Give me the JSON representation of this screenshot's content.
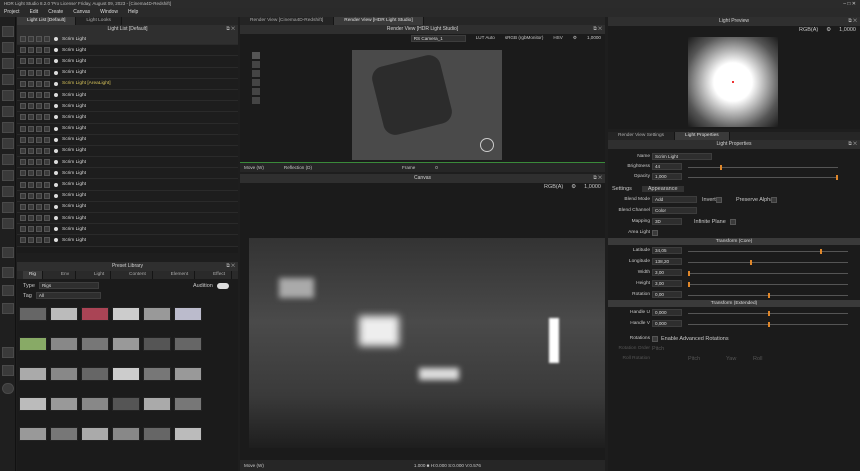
{
  "app": {
    "title": "HDR Light Studio 8.2.0 'Pro License' Friday, August 09, 2023 - [Cinema4D-Redshift]",
    "menu": [
      "Project",
      "Edit",
      "Create",
      "Canvas",
      "Window",
      "Help"
    ],
    "win_btns": "–  □  ✕"
  },
  "light_list": {
    "tabs": [
      "Light List [Default]",
      "Light Looks"
    ],
    "header": "Light List [Default]",
    "rows": [
      {
        "label": "Scrim Light"
      },
      {
        "label": "Scrim Light"
      },
      {
        "label": "Scrim Light"
      },
      {
        "label": "Scrim Light"
      },
      {
        "label": "Scrim Light [AreaLight]"
      },
      {
        "label": "Scrim Light"
      },
      {
        "label": "Scrim Light"
      },
      {
        "label": "Scrim Light"
      },
      {
        "label": "Scrim Light"
      },
      {
        "label": "Scrim Light"
      },
      {
        "label": "Scrim Light"
      },
      {
        "label": "Scrim Light"
      },
      {
        "label": "Scrim Light"
      },
      {
        "label": "Scrim Light"
      },
      {
        "label": "Scrim Light"
      },
      {
        "label": "Scrim Light"
      },
      {
        "label": "Scrim Light"
      },
      {
        "label": "Scrim Light"
      },
      {
        "label": "Scrim Light"
      }
    ]
  },
  "preset": {
    "header": "Preset Library",
    "tabs": [
      "Rig",
      "Env",
      "Light",
      "Content",
      "Element",
      "Effect"
    ],
    "type_label": "Type",
    "type_value": "Rigs",
    "tag_label": "Tag",
    "tag_value": "All",
    "audition": "Audition"
  },
  "render": {
    "tabs": [
      "Render View [Cinema4D-Redshift]",
      "Render View [HDR Light Studio]"
    ],
    "header": "Render View [HDR Light Studio]",
    "camera": "RS Camera_1",
    "lut": "LUT Auto",
    "colorspace": "sRGB (rgbMonitor)",
    "mode": "HSV",
    "value": "1,0000",
    "move": "Move (W)",
    "reflection": "Reflection (D)",
    "frame_label": "Frame",
    "frame_value": "0"
  },
  "canvas": {
    "header": "Canvas",
    "channel": "RGB(A)",
    "value": "1,0000",
    "move": "Move (W)",
    "status": "1.000 ■ H:0.000 S:0.000 V:0.576"
  },
  "preview": {
    "header": "Light Preview",
    "channel": "RGB(A)",
    "value": "1,0000"
  },
  "props": {
    "tabs": [
      "Render View Settings",
      "Light Properties"
    ],
    "header": "Light Properties",
    "name_label": "Name",
    "name_value": "Scrim Light",
    "brightness_label": "Brightness",
    "brightness_value": "44",
    "opacity_label": "Opacity",
    "opacity_value": "1,000",
    "subtabs": [
      "Settings",
      "Appearance"
    ],
    "blend_label": "Blend Mode",
    "blend_value": "Add",
    "invert": "Invert",
    "preserve_alpha": "Preserve Alpha",
    "channel_label": "Blend Channel",
    "channel_value": "Color",
    "mapping_label": "Mapping",
    "mapping_value": "3D",
    "infinite": "Infinite Plane",
    "area_label": "Area Light",
    "transform_core": "Transform (Core)",
    "latitude_label": "Latitude",
    "latitude_value": "34,05",
    "longitude_label": "Longitude",
    "longitude_value": "138,20",
    "width_label": "Width",
    "width_value": "3,00",
    "height_label": "Height",
    "height_value": "3,00",
    "rotation_label": "Rotation",
    "rotation_value": "0,00",
    "transform_ext": "Transform (Extended)",
    "handleu_label": "Handle U",
    "handleu_value": "0,000",
    "handlev_label": "Handle V",
    "handlev_value": "0,000",
    "rotations_label": "Rotations",
    "adv_rot": "Enable Advanced Rotations",
    "rot_order_label": "Rotation Order",
    "rot_order_value": "Pitch",
    "rot_axis_label": "Roll Rotation",
    "pitch": "Pitch",
    "yaw": "Yaw",
    "roll": "Roll"
  },
  "colors": {
    "accent": "#e0872a",
    "bg": "#1e1e1e"
  }
}
